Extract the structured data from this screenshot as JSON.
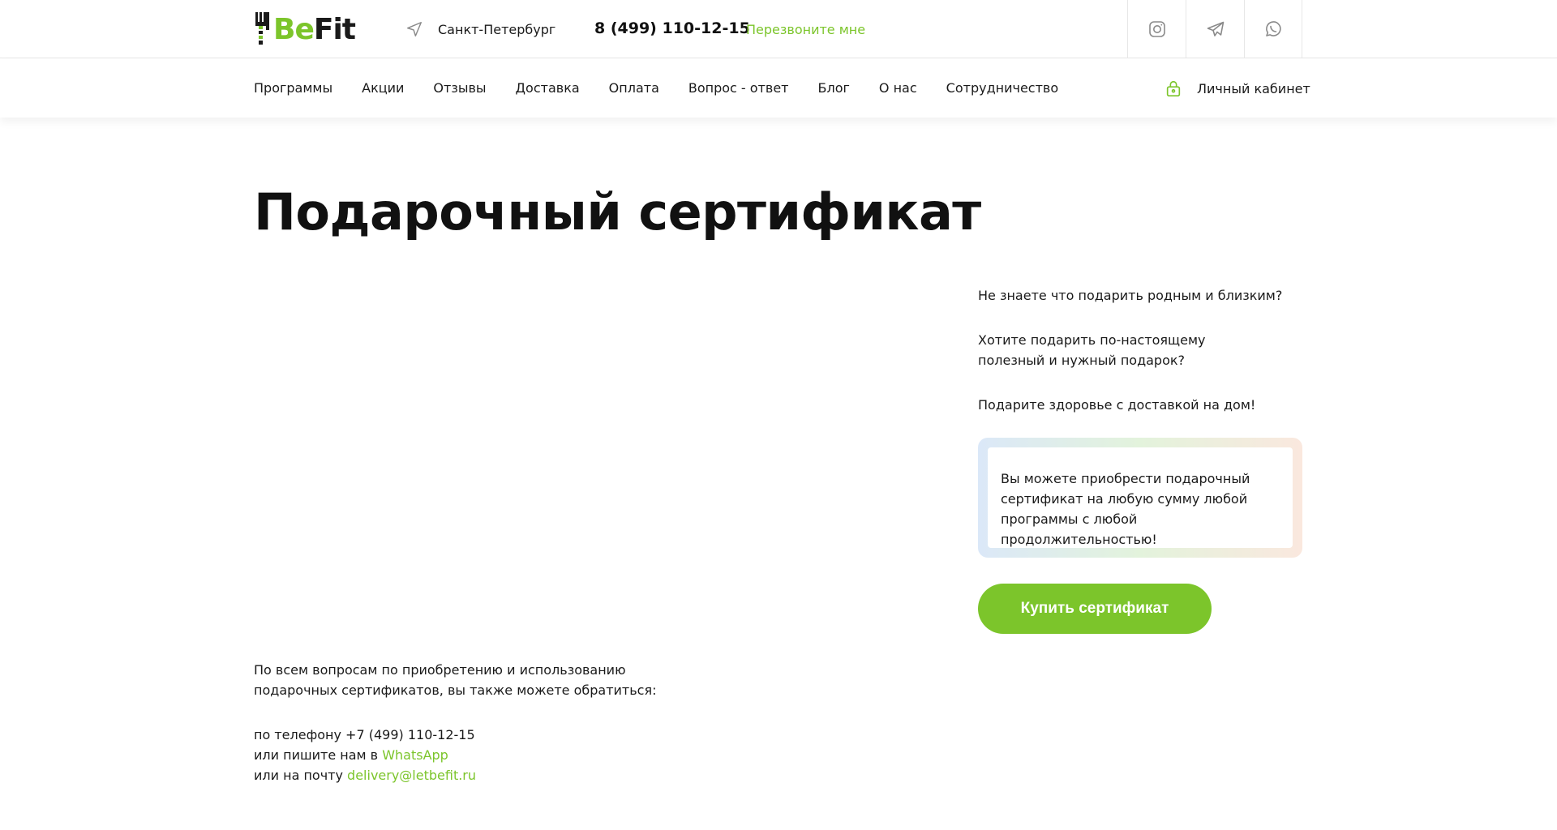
{
  "brand": {
    "logo_be": "Be",
    "logo_fit": "Fit",
    "accent": "#7cc52b"
  },
  "header": {
    "city_icon": "location-arrow-icon",
    "city": "Санкт-Петербург",
    "phone": "8 (499) 110-12-15",
    "callback": "Перезвоните мне",
    "socials": [
      {
        "icon": "instagram-icon"
      },
      {
        "icon": "telegram-icon"
      },
      {
        "icon": "whatsapp-icon"
      }
    ]
  },
  "nav": {
    "items": [
      "Программы",
      "Акции",
      "Отзывы",
      "Доставка",
      "Оплата",
      "Вопрос - ответ",
      "Блог",
      "О нас",
      "Сотрудничество"
    ],
    "account_icon": "lock-icon",
    "account": "Личный кабинет"
  },
  "main": {
    "title": "Подарочный сертификат",
    "questions": [
      "Не знаете что подарить родным и близким?",
      "Хотите подарить по-настоящему полезный и нужный подарок?",
      "Подарите здоровье с доставкой на дом!"
    ],
    "box_text": "Вы можете приобрести подарочный сертификат на любую сумму любой программы с любой продолжительностью!",
    "buy_button": "Купить сертификат"
  },
  "contacts": {
    "intro": "По всем вопросам по приобретению и использованию подарочных сертификатов, вы также можете обратиться:",
    "phone_line": "по телефону +7 (499) 110-12-15",
    "whatsapp_prefix": "или пишите нам в ",
    "whatsapp_link": "WhatsApp",
    "email_prefix": "или на почту ",
    "email_link": "delivery@letbefit.ru"
  }
}
